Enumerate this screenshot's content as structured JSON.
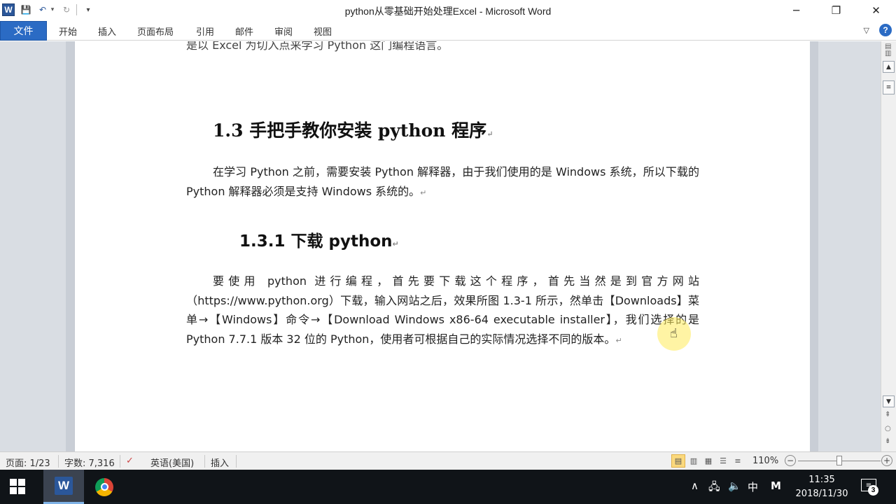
{
  "window": {
    "title": "python从零基础开始处理Excel  -  Microsoft Word",
    "app_icon": "W",
    "minimize": "─",
    "restore": "❐",
    "close": "✕"
  },
  "quick_access": {
    "save_icon": "💾",
    "undo_icon": "↶",
    "undo_dropdown": "▾",
    "redo_icon": "↻",
    "customize_icon": "▾"
  },
  "ribbon": {
    "file_tab": "文件",
    "tabs": [
      "开始",
      "插入",
      "页面布局",
      "引用",
      "邮件",
      "审阅",
      "视图"
    ],
    "minimize_icon": "♡",
    "help_icon": "?"
  },
  "document": {
    "cut_line": "是以 Excel 为切入点来学习 Python 这门编程语言。",
    "heading_1_3": "1.3  手把手教你安装 python 程序",
    "para1": "在学习 Python 之前，需要安装 Python 解释器，由于我们使用的是 Windows 系统，所以下载的 Python 解释器必须是支持 Windows 系统的。",
    "heading_1_3_1": "1.3.1  下载 python",
    "para2": "要使用 python 进行编程，首先要下载这个程序，首先当然是到官方网站（https://www.python.org）下载，输入网站之后，效果所图 1.3-1 所示，然单击【Downloads】菜单→【Windows】命令→【Download Windows x86-64 executable installer】，我们选择的是 Python 7.7.1 版本 32 位的 Python，使用者可根据自己的实际情况选择不同的版本。",
    "paragraph_mark": "↵"
  },
  "statusbar": {
    "page": "页面: 1/23",
    "words": "字数: 7,316",
    "language": "英语(美国)",
    "mode": "插入",
    "zoom": "110%",
    "zoom_minus": "−",
    "zoom_plus": "+"
  },
  "taskbar": {
    "word_icon": "W",
    "tray": {
      "chevron": "∧",
      "network": "🖧",
      "volume": "🔈",
      "ime": "中",
      "ime2": "M"
    },
    "time": "11:35",
    "date": "2018/11/30",
    "notifications": "3"
  }
}
